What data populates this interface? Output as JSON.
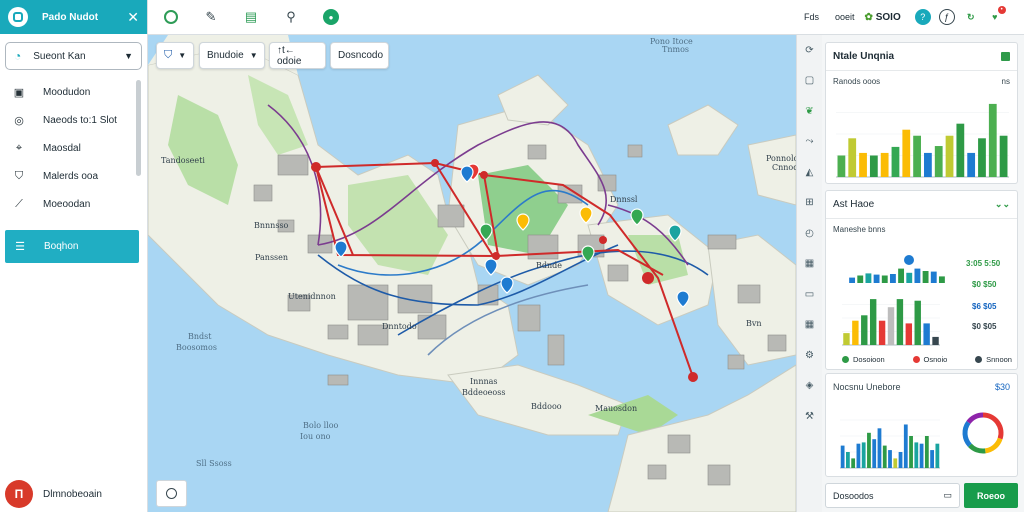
{
  "sidebar": {
    "title": "Pado Nudot",
    "search_label": "Sueont Kan",
    "items": [
      {
        "label": "Moodudon",
        "icon": "note-icon"
      },
      {
        "label": "Naeods to:1 Slot",
        "icon": "camera-icon"
      },
      {
        "label": "Maosdal",
        "icon": "pin-icon"
      },
      {
        "label": "Malerds ooa",
        "icon": "shirt-icon"
      },
      {
        "label": "Moeoodan",
        "icon": "chart-line-icon"
      },
      {
        "label": "Boqhon",
        "icon": "menu-icon"
      }
    ],
    "user_name": "Dlmnobeoain",
    "user_initial": "Π"
  },
  "toolbar": {
    "icons": [
      "globe-icon",
      "pen-icon",
      "layers-icon",
      "search-icon",
      "record-icon"
    ]
  },
  "map": {
    "controls": [
      {
        "label": "",
        "icon": "shield-icon"
      },
      {
        "label": "Bnudoie"
      },
      {
        "label": "↑t← odoie"
      },
      {
        "label": "Dosncodo"
      }
    ],
    "labels": [
      {
        "text": "Pono Itoce",
        "kind": "sea"
      },
      {
        "text": "Tnmos",
        "kind": "sea"
      },
      {
        "text": "Tandoseeti",
        "kind": "land"
      },
      {
        "text": "Ponnolo",
        "kind": "land"
      },
      {
        "text": "Cnnodo",
        "kind": "land"
      },
      {
        "text": "Bnnnsso",
        "kind": "land"
      },
      {
        "text": "Utenidnnon",
        "kind": "land"
      },
      {
        "text": "Dnntodo",
        "kind": "land"
      },
      {
        "text": "Bndst",
        "kind": "sea"
      },
      {
        "text": "Boosomos",
        "kind": "sea"
      },
      {
        "text": "Innnas",
        "kind": "land"
      },
      {
        "text": "Bddeoeoss",
        "kind": "land"
      },
      {
        "text": "Bddooo",
        "kind": "land"
      },
      {
        "text": "Mauosdon",
        "kind": "land"
      },
      {
        "text": "Bolo lloo",
        "kind": "sea"
      },
      {
        "text": "Iou ono",
        "kind": "sea"
      },
      {
        "text": "Sll Ssoss",
        "kind": "sea"
      },
      {
        "text": "Panssen",
        "kind": "land"
      },
      {
        "text": "Bdnde",
        "kind": "land"
      },
      {
        "text": "Dnnssl",
        "kind": "land"
      },
      {
        "text": "Bvn",
        "kind": "land"
      }
    ]
  },
  "right_strip": {
    "icons": [
      "refresh-icon",
      "bookmark-icon",
      "leaf-icon",
      "route-icon",
      "car-icon",
      "grid-icon",
      "clock-icon",
      "table-icon",
      "folder-icon",
      "table-icon",
      "settings-icon",
      "compass-icon",
      "tools-icon"
    ]
  },
  "header_right": {
    "label": "Fds",
    "user": "ooeit",
    "brand": "SOIO"
  },
  "panel": {
    "card1": {
      "title": "Ntale Unqnia",
      "subtitle": "Ranods ooos",
      "value": "ns"
    },
    "card2": {
      "title": "Ast  Haoe",
      "subtitle": "Maneshe bnns",
      "stats": [
        {
          "text": "3:05 5:50",
          "color": "#2e9a46"
        },
        {
          "text": "$0 $50",
          "color": "#2e9a46"
        },
        {
          "text": "$6 $05",
          "color": "#1565c0"
        },
        {
          "text": "$0 $05",
          "color": "#37474f"
        }
      ],
      "legend": [
        {
          "label": "Dosoioon",
          "color": "#2e9a46"
        },
        {
          "label": "Osnoio",
          "color": "#e53935"
        },
        {
          "label": "Snnoon",
          "color": "#37474f"
        }
      ]
    },
    "card3": {
      "title": "Nocsnu Unebore",
      "value": "$30"
    },
    "bottom": {
      "input_label": "Dosoodos",
      "button_label": "Roeoo"
    }
  },
  "chart_data": [
    {
      "type": "bar",
      "categories": [
        "1",
        "2",
        "3",
        "4",
        "5",
        "6",
        "7",
        "8",
        "9",
        "10",
        "11",
        "12",
        "13",
        "14",
        "15",
        "16"
      ],
      "series": [
        {
          "values": [
            25,
            45,
            28,
            25,
            28,
            35,
            55,
            48,
            28,
            36,
            48,
            62,
            28,
            45,
            85,
            48
          ]
        }
      ]
    },
    {
      "type": "bar",
      "categories": [
        "1",
        "2",
        "3",
        "4",
        "5",
        "6",
        "7",
        "8",
        "9",
        "10",
        "11",
        "12"
      ],
      "series": [
        {
          "values": [
            18,
            25,
            32,
            28,
            25,
            30,
            48,
            34,
            48,
            40,
            38,
            22
          ]
        }
      ]
    },
    {
      "type": "bar",
      "categories": [
        "1",
        "2",
        "3",
        "4",
        "5",
        "6",
        "7",
        "8",
        "9",
        "10",
        "11"
      ],
      "series": [
        {
          "values": [
            22,
            45,
            55,
            85,
            45,
            70,
            85,
            40,
            82,
            40,
            15
          ]
        }
      ]
    },
    {
      "type": "bar",
      "categories": [
        "1",
        "2",
        "3",
        "4",
        "5",
        "6",
        "7",
        "8",
        "9",
        "10",
        "11",
        "12",
        "13",
        "14",
        "15",
        "16",
        "17",
        "18",
        "19"
      ],
      "series": [
        {
          "values": [
            35,
            25,
            15,
            38,
            40,
            55,
            45,
            62,
            35,
            28,
            15,
            25,
            68,
            50,
            40,
            38,
            50,
            28,
            38
          ]
        }
      ]
    },
    {
      "type": "pie",
      "series": [
        {
          "values": [
            30,
            18,
            15,
            22,
            15
          ]
        }
      ]
    }
  ]
}
